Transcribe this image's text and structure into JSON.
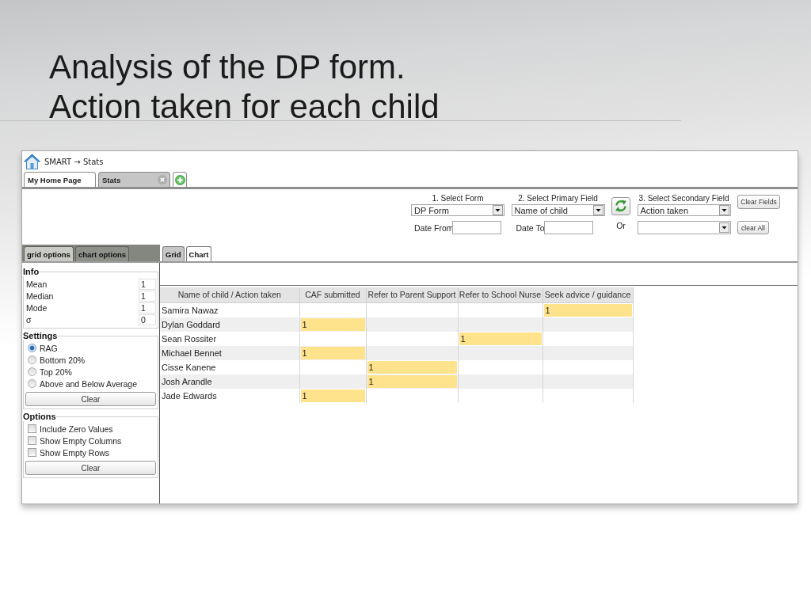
{
  "title_lines": [
    "Analysis of the DP form.",
    "Action taken for each child"
  ],
  "breadcrumb": "SMART → Stats",
  "tabs": [
    {
      "label": "My Home Page",
      "selected": false,
      "closable": false
    },
    {
      "label": "Stats",
      "selected": true,
      "closable": true
    }
  ],
  "toolbar": {
    "selectors": [
      {
        "label": "1. Select Form",
        "value": "DP Form"
      },
      {
        "label": "2. Select Primary Field",
        "value": "Name of child"
      },
      {
        "label": "3. Select Secondary Field",
        "value": "Action taken"
      }
    ],
    "clear_fields_button": "Clear Fields",
    "date_from_label": "Date From",
    "date_to_label": "Date To",
    "or_label": "Or",
    "clear_all_button": "clear All"
  },
  "panel_tabs": [
    {
      "label": "grid options",
      "selected": true
    },
    {
      "label": "chart options",
      "selected": false
    }
  ],
  "view_tabs": [
    {
      "label": "Grid",
      "selected": true
    },
    {
      "label": "Chart",
      "selected": false
    }
  ],
  "info": {
    "title": "Info",
    "stats": [
      {
        "label": "Mean",
        "value": "1"
      },
      {
        "label": "Median",
        "value": "1"
      },
      {
        "label": "Mode",
        "value": "1"
      },
      {
        "label": "σ",
        "value": "0"
      }
    ]
  },
  "settings": {
    "title": "Settings",
    "options": [
      {
        "label": "RAG",
        "selected": true
      },
      {
        "label": "Bottom 20%",
        "selected": false
      },
      {
        "label": "Top 20%",
        "selected": false
      },
      {
        "label": "Above and Below Average",
        "selected": false
      }
    ],
    "button": "Clear"
  },
  "options": {
    "title": "Options",
    "items": [
      {
        "label": "Include Zero Values",
        "checked": false
      },
      {
        "label": "Show Empty Columns",
        "checked": false
      },
      {
        "label": "Show Empty Rows",
        "checked": false
      }
    ],
    "button": "Clear"
  },
  "grid": {
    "corner_header": "Name of child / Action taken",
    "columns": [
      "CAF submitted",
      "Refer to Parent Support",
      "Refer to School Nurse",
      "Seek advice / guidance"
    ],
    "rows": [
      {
        "name": "Samira Nawaz",
        "cells": [
          "",
          "",
          "",
          "1"
        ]
      },
      {
        "name": "Dylan Goddard",
        "cells": [
          "1",
          "",
          "",
          ""
        ]
      },
      {
        "name": "Sean Rossiter",
        "cells": [
          "",
          "",
          "1",
          ""
        ]
      },
      {
        "name": "Michael Bennet",
        "cells": [
          "1",
          "",
          "",
          ""
        ]
      },
      {
        "name": "Cisse Kanene",
        "cells": [
          "",
          "1",
          "",
          ""
        ]
      },
      {
        "name": "Josh Arandle",
        "cells": [
          "",
          "1",
          "",
          ""
        ]
      },
      {
        "name": "Jade Edwards",
        "cells": [
          "1",
          "",
          "",
          ""
        ]
      }
    ]
  }
}
